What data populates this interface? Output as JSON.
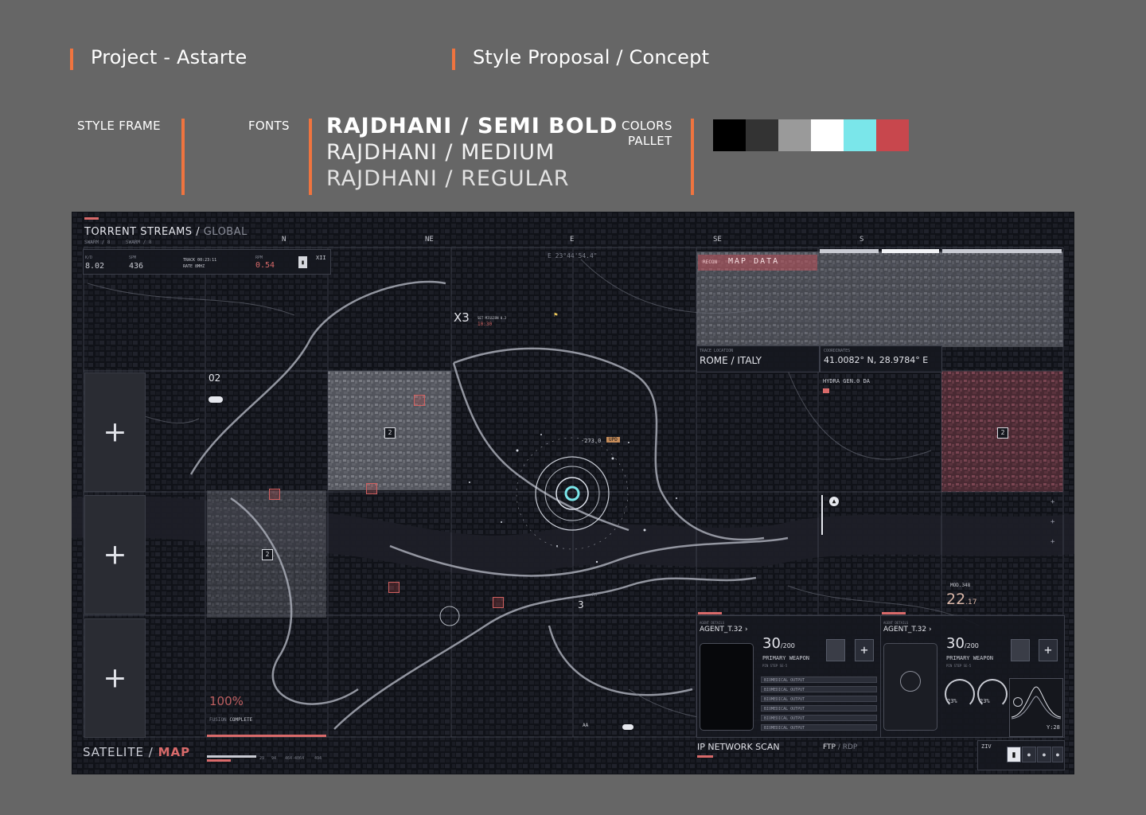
{
  "header": {
    "project": "Project - Astarte",
    "proposal": "Style Proposal / Concept"
  },
  "style_frame_label": "STYLE FRAME",
  "fonts": {
    "label": "FONTS",
    "samples": [
      "RAJDHANI / SEMI BOLD",
      "RAJDHANI / MEDIUM",
      "RAJDHANI / REGULAR"
    ]
  },
  "colors": {
    "label_line1": "COLORS",
    "label_line2": "PALLET",
    "swatches": [
      "#000000",
      "#333333",
      "#9a9a9a",
      "#ffffff",
      "#7ae6ea",
      "#c8474d"
    ]
  },
  "map": {
    "title_main": "TORRENT STREAMS",
    "title_sub": "GLOBAL",
    "title_small_1": "SWARM / 8",
    "title_small_2": "SWARM / 8",
    "compass": [
      "N",
      "NE",
      "E",
      "SE",
      "S"
    ],
    "coord_top": "E 23°44'54.4\"",
    "stats": {
      "kd_label": "K/D",
      "kd_value": "8.02",
      "spm_label": "SPM",
      "spm_value": "436",
      "track_label": "TRACK 00:23:11",
      "rate_label": "RATE 8MHZ",
      "rpm_label": "RPM",
      "rpm_value": "0.54",
      "roman": "XII"
    },
    "x3_label": "X3",
    "x3_sub": "SET MISSION 0.2",
    "x3_time": "10:30",
    "sector_02": "02",
    "depth_label": "-273.0",
    "upd_label": "UPD",
    "map_data_label": "MAP DATA",
    "map_data_prefix": "RECON",
    "trace_location_label": "TRACE LOCATION",
    "trace_location_value": "ROME / ITALY",
    "coordinates_label": "COORDINATES",
    "coordinates_value": "41.0082° N, 28.9784° E",
    "hydra_label": "HYDRA GEN.0 DA",
    "mod_label": "MOD.348",
    "mod_value": "22",
    "mod_decimal": ".17",
    "fusion_percent": "100%",
    "fusion_label_1": "FUSION",
    "fusion_label_2": "COMPLETE",
    "satelite_label": "SATELITE",
    "map_label": "MAP",
    "bottom_numbers": [
      "29",
      "94",
      "464-4064",
      "494"
    ],
    "aa_label": "AA",
    "marker_2": "2",
    "marker_3": "3",
    "r7_label": "R7",
    "ip_scan_label": "IP NETWORK SCAN",
    "ftp_label": "FTP",
    "rdp_label": "RDP",
    "ziv_label": "ZIV",
    "agent_panels": [
      {
        "details_label": "AGENT DETAILS",
        "name": "AGENT_T.32 ›",
        "ammo": "30",
        "ammo_max": "/200",
        "weapon": "PRIMARY WEAPON",
        "weapon_sub": "PIN STEP SE-5"
      },
      {
        "details_label": "AGENT DETAILS",
        "name": "AGENT_T.32 ›",
        "ammo": "30",
        "ammo_max": "/200",
        "weapon": "PRIMARY WEAPON",
        "weapon_sub": "PIN STEP SE-5"
      }
    ],
    "output_rows": [
      "BIOMEDICAL OUTPUT",
      "BIOMEDICAL OUTPUT",
      "BIOMEDICAL OUTPUT",
      "BIOMEDICAL OUTPUT",
      "BIOMEDICAL OUTPUT",
      "BIOMEDICAL OUTPUT"
    ],
    "gauge_values": [
      "23%",
      "23%"
    ],
    "y_value": "Y:28",
    "accent_pink": "#d96a6a",
    "accent_cyan": "#7ae6ea"
  }
}
